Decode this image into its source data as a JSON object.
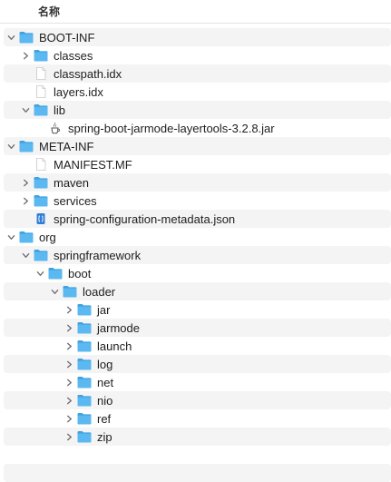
{
  "header": {
    "name_column": "名称"
  },
  "tree": [
    {
      "label": "BOOT-INF",
      "type": "folder",
      "depth": 0,
      "disclosure": "expanded"
    },
    {
      "label": "classes",
      "type": "folder",
      "depth": 1,
      "disclosure": "collapsed"
    },
    {
      "label": "classpath.idx",
      "type": "file",
      "depth": 1,
      "disclosure": "none"
    },
    {
      "label": "layers.idx",
      "type": "file",
      "depth": 1,
      "disclosure": "none"
    },
    {
      "label": "lib",
      "type": "folder",
      "depth": 1,
      "disclosure": "expanded"
    },
    {
      "label": "spring-boot-jarmode-layertools-3.2.8.jar",
      "type": "jar",
      "depth": 2,
      "disclosure": "none"
    },
    {
      "label": "META-INF",
      "type": "folder",
      "depth": 0,
      "disclosure": "expanded"
    },
    {
      "label": "MANIFEST.MF",
      "type": "file",
      "depth": 1,
      "disclosure": "none"
    },
    {
      "label": "maven",
      "type": "folder",
      "depth": 1,
      "disclosure": "collapsed"
    },
    {
      "label": "services",
      "type": "folder",
      "depth": 1,
      "disclosure": "collapsed"
    },
    {
      "label": "spring-configuration-metadata.json",
      "type": "json",
      "depth": 1,
      "disclosure": "none"
    },
    {
      "label": "org",
      "type": "folder",
      "depth": 0,
      "disclosure": "expanded"
    },
    {
      "label": "springframework",
      "type": "folder",
      "depth": 1,
      "disclosure": "expanded"
    },
    {
      "label": "boot",
      "type": "folder",
      "depth": 2,
      "disclosure": "expanded"
    },
    {
      "label": "loader",
      "type": "folder",
      "depth": 3,
      "disclosure": "expanded"
    },
    {
      "label": "jar",
      "type": "folder",
      "depth": 4,
      "disclosure": "collapsed"
    },
    {
      "label": "jarmode",
      "type": "folder",
      "depth": 4,
      "disclosure": "collapsed"
    },
    {
      "label": "launch",
      "type": "folder",
      "depth": 4,
      "disclosure": "collapsed"
    },
    {
      "label": "log",
      "type": "folder",
      "depth": 4,
      "disclosure": "collapsed"
    },
    {
      "label": "net",
      "type": "folder",
      "depth": 4,
      "disclosure": "collapsed"
    },
    {
      "label": "nio",
      "type": "folder",
      "depth": 4,
      "disclosure": "collapsed"
    },
    {
      "label": "ref",
      "type": "folder",
      "depth": 4,
      "disclosure": "collapsed"
    },
    {
      "label": "zip",
      "type": "folder",
      "depth": 4,
      "disclosure": "collapsed"
    }
  ],
  "colors": {
    "folder": "#5bb8f0",
    "folder_tab": "#3ea3e0",
    "alt_row": "#f4f4f4",
    "disclosure": "#6e6e73"
  }
}
